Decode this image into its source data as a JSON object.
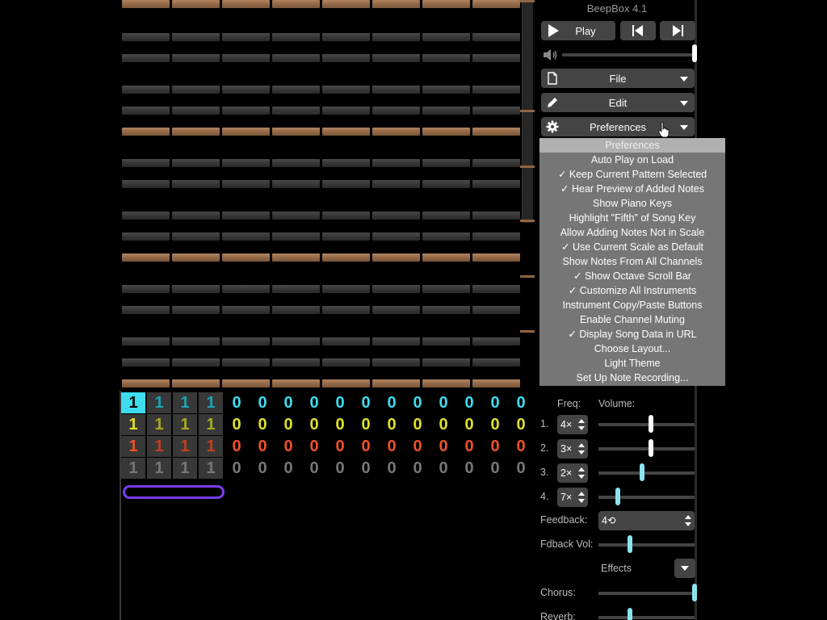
{
  "app": {
    "title": "BeepBox 4.1"
  },
  "controls": {
    "play_label": "Play",
    "prev_bar_icon": "skip-back-icon",
    "next_bar_icon": "skip-forward-icon",
    "volume_icon": "speaker-icon",
    "volume_level": 1.0
  },
  "menus": {
    "file_label": "File",
    "edit_label": "Edit",
    "preferences_label": "Preferences"
  },
  "preferences_menu": {
    "items": [
      "Preferences",
      "Auto Play on Load",
      "✓ Keep Current Pattern Selected",
      "✓ Hear Preview of Added Notes",
      "Show Piano Keys",
      "Highlight \"Fifth\" of Song Key",
      "Allow Adding Notes Not in Scale",
      "✓ Use Current Scale as Default",
      "Show Notes From All Channels",
      "✓ Show Octave Scroll Bar",
      "✓ Customize All Instruments",
      "Instrument Copy/Paste Buttons",
      "Enable Channel Muting",
      "✓ Display Song Data in URL",
      "Choose Layout...",
      "Light Theme",
      "Set Up Note Recording..."
    ]
  },
  "operators": {
    "freq_label": "Freq:",
    "volume_label": "Volume:",
    "rows": [
      {
        "num": "1.",
        "freq": "4×",
        "volume": 0.55
      },
      {
        "num": "2.",
        "freq": "3×",
        "volume": 0.55
      },
      {
        "num": "3.",
        "freq": "2×",
        "volume": 0.45
      },
      {
        "num": "4.",
        "freq": "7×",
        "volume": 0.2
      }
    ]
  },
  "feedback": {
    "label": "Feedback:",
    "value": "4⟲"
  },
  "fdback_vol": {
    "label": "Fdback Vol:",
    "level": 0.33
  },
  "effects": {
    "label": "Effects"
  },
  "chorus": {
    "label": "Chorus:",
    "level": 1.0
  },
  "reverb": {
    "label": "Reverb:",
    "level": 0.33
  },
  "tracks": {
    "channels": [
      {
        "color": "#3fdcf0",
        "dim": "#1aa5b5",
        "values": [
          "1",
          "1",
          "1",
          "1",
          "0",
          "0",
          "0",
          "0",
          "0",
          "0",
          "0",
          "0",
          "0",
          "0",
          "0",
          "0"
        ]
      },
      {
        "color": "#e0e028",
        "dim": "#a8a820",
        "values": [
          "1",
          "1",
          "1",
          "1",
          "0",
          "0",
          "0",
          "0",
          "0",
          "0",
          "0",
          "0",
          "0",
          "0",
          "0",
          "0"
        ]
      },
      {
        "color": "#f0502a",
        "dim": "#c0401f",
        "values": [
          "1",
          "1",
          "1",
          "1",
          "0",
          "0",
          "0",
          "0",
          "0",
          "0",
          "0",
          "0",
          "0",
          "0",
          "0",
          "0"
        ]
      },
      {
        "color": "#777777",
        "dim": "#777777",
        "values": [
          "1",
          "1",
          "1",
          "1",
          "0",
          "0",
          "0",
          "0",
          "0",
          "0",
          "0",
          "0",
          "0",
          "0",
          "0",
          "0"
        ]
      }
    ]
  }
}
